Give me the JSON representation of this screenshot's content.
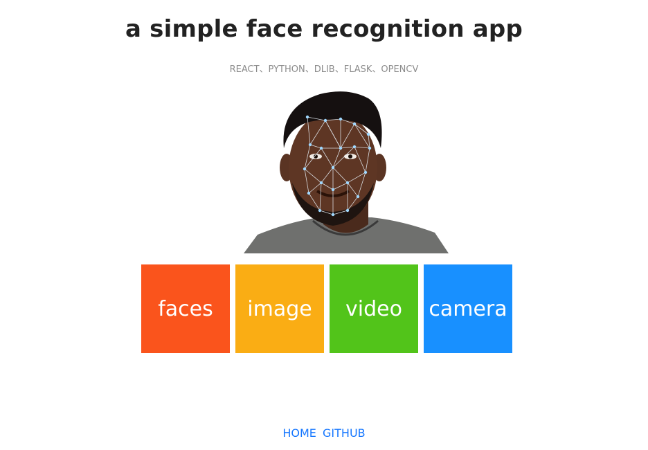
{
  "header": {
    "title": "a simple face recognition app",
    "subtitle": "REACT、PYTHON、DLIB、FLASK、OPENCV"
  },
  "hero": {
    "alt": "face with recognition landmark mesh"
  },
  "tiles": [
    {
      "label": "faces",
      "color": "#fa541c"
    },
    {
      "label": "image",
      "color": "#faad14"
    },
    {
      "label": "video",
      "color": "#52c41a"
    },
    {
      "label": "camera",
      "color": "#1890ff"
    }
  ],
  "footer": {
    "links": [
      {
        "label": "HOME"
      },
      {
        "label": "GITHUB"
      }
    ],
    "link_color": "#1677ff"
  }
}
